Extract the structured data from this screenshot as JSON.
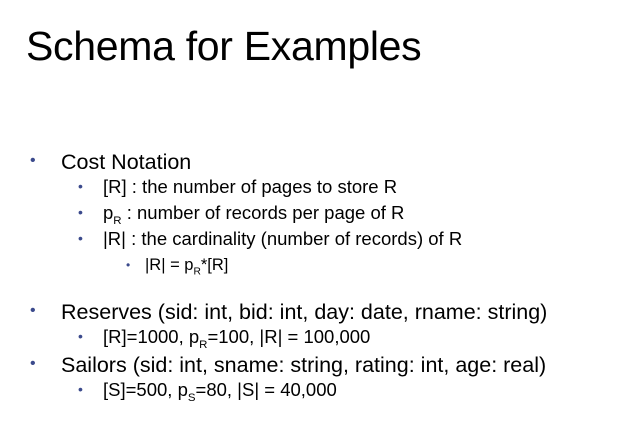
{
  "slide": {
    "title": "Schema for Examples",
    "items": [
      {
        "text": "Cost Notation"
      },
      {
        "text": "[R] : the number of pages to store R"
      },
      {
        "pre": "p",
        "sub": "R",
        "post": " : number of records per page of R"
      },
      {
        "text": "|R| : the cardinality (number of records) of R"
      },
      {
        "pre": "|R| = p",
        "sub": "R",
        "post": "*[R]"
      },
      {
        "text": "Reserves (sid: int, bid: int, day: date, rname: string)"
      },
      {
        "pre": "[R]=1000, p",
        "sub": "R",
        "post": "=100, |R| = 100,000"
      },
      {
        "text": "Sailors (sid: int, sname: string, rating: int, age: real)"
      },
      {
        "pre": "[S]=500, p",
        "sub": "S",
        "post": "=80, |S| = 40,000"
      }
    ],
    "bullet_char": "•",
    "bullet_color": "#3b4a8c"
  }
}
